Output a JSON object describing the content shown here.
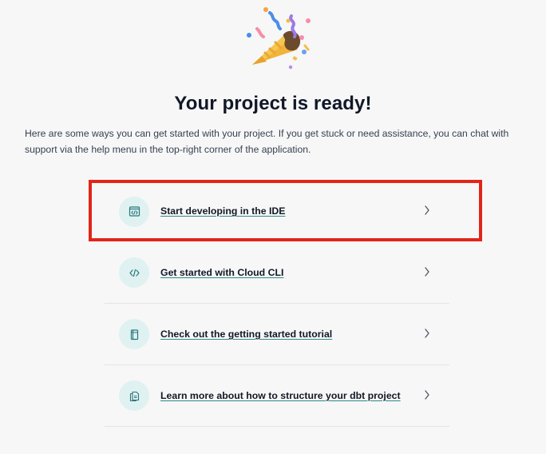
{
  "header": {
    "title": "Your project is ready!",
    "description": "Here are some ways you can get started with your project. If you get stuck or need assistance, you can chat with support via the help menu in the top-right corner of the application."
  },
  "options": [
    {
      "label": "Start developing in the IDE",
      "icon": "ide-icon"
    },
    {
      "label": "Get started with Cloud CLI",
      "icon": "code-icon"
    },
    {
      "label": "Check out the getting started tutorial",
      "icon": "tutorial-icon"
    },
    {
      "label": "Learn more about how to structure your dbt project",
      "icon": "documents-icon"
    }
  ],
  "colors": {
    "background": "#f7f7f7",
    "highlight": "#e22519",
    "icon_circle": "#dff1f1",
    "icon_color": "#28787a",
    "link_underline": "#2f8a84"
  }
}
